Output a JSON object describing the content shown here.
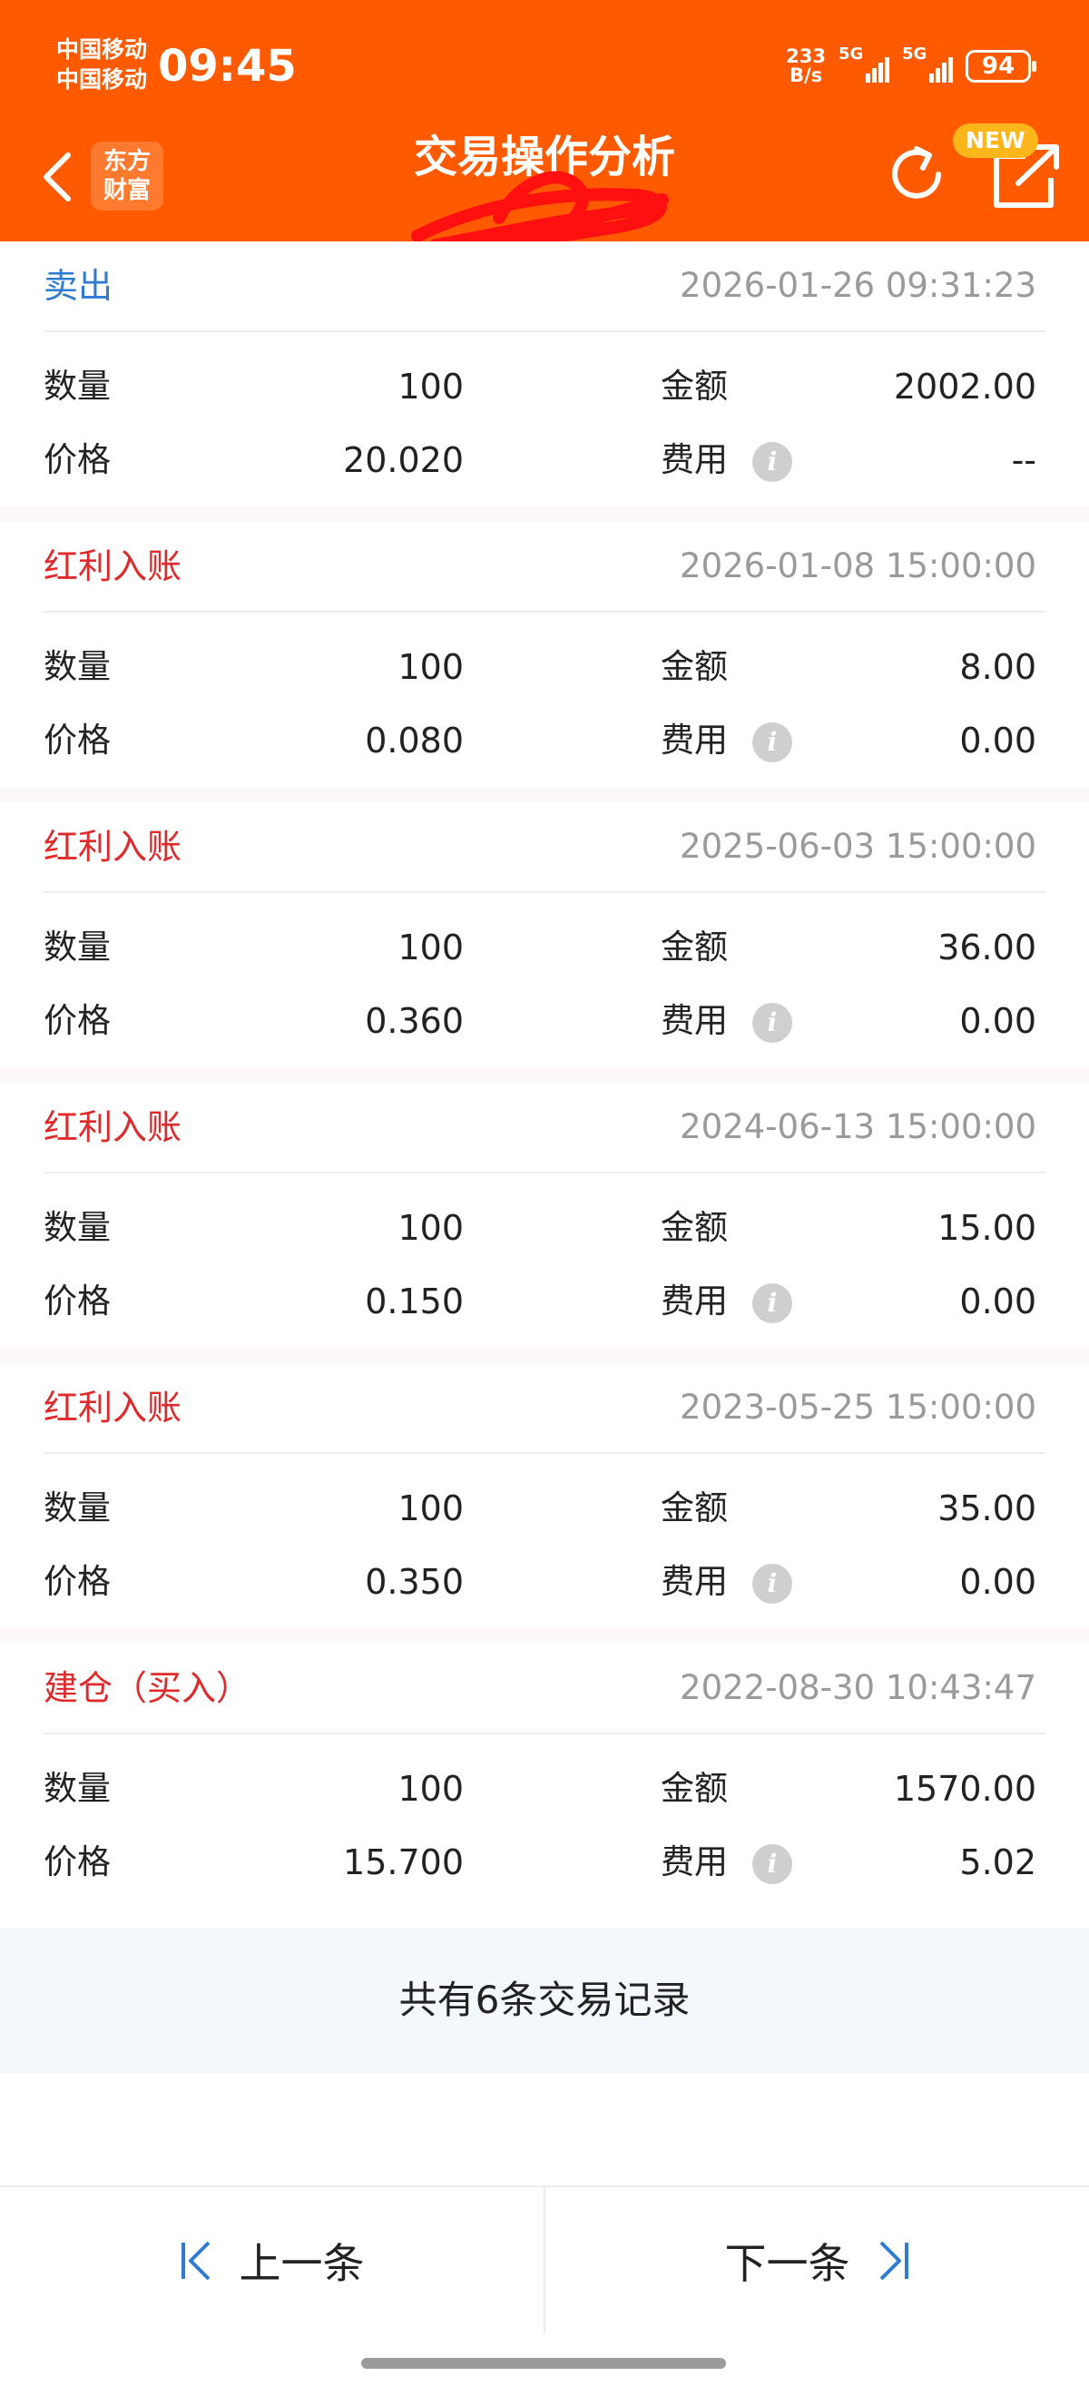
{
  "status_bar": {
    "carrier1": "中国移动",
    "carrier2": "中国移动",
    "time": "09:45",
    "net_speed_value": "233",
    "net_speed_unit": "B/s",
    "sig1": "5G",
    "sig2": "5G",
    "battery": "94"
  },
  "header": {
    "title": "交易操作分析",
    "logo_line1": "东方",
    "logo_line2": "财富",
    "new_badge": "NEW",
    "icons": [
      "back-icon",
      "refresh-icon",
      "share-icon"
    ]
  },
  "labels": {
    "quantity": "数量",
    "price": "价格",
    "amount": "金额",
    "fee": "费用",
    "info": "i"
  },
  "records": [
    {
      "type": "卖出",
      "time": "2026-01-26 09:31:23",
      "quantity": "100",
      "price": "20.020",
      "amount": "2002.00",
      "fee": "--"
    },
    {
      "type": "红利入账",
      "time": "2026-01-08 15:00:00",
      "quantity": "100",
      "price": "0.080",
      "amount": "8.00",
      "fee": "0.00"
    },
    {
      "type": "红利入账",
      "time": "2025-06-03 15:00:00",
      "quantity": "100",
      "price": "0.360",
      "amount": "36.00",
      "fee": "0.00"
    },
    {
      "type": "红利入账",
      "time": "2024-06-13 15:00:00",
      "quantity": "100",
      "price": "0.150",
      "amount": "15.00",
      "fee": "0.00"
    },
    {
      "type": "红利入账",
      "time": "2023-05-25 15:00:00",
      "quantity": "100",
      "price": "0.350",
      "amount": "35.00",
      "fee": "0.00"
    },
    {
      "type": "建仓（买入）",
      "time": "2022-08-30 10:43:47",
      "quantity": "100",
      "price": "15.700",
      "amount": "1570.00",
      "fee": "5.02"
    }
  ],
  "summary": "共有6条交易记录",
  "nav": {
    "prev": "上一条",
    "next": "下一条"
  },
  "colors": {
    "header_bg": "#ff5a00",
    "sell": "#2e7bd1",
    "dividend": "#e0292a",
    "time_gray": "#9a9a9a",
    "nav_icon": "#2e7bd1"
  }
}
